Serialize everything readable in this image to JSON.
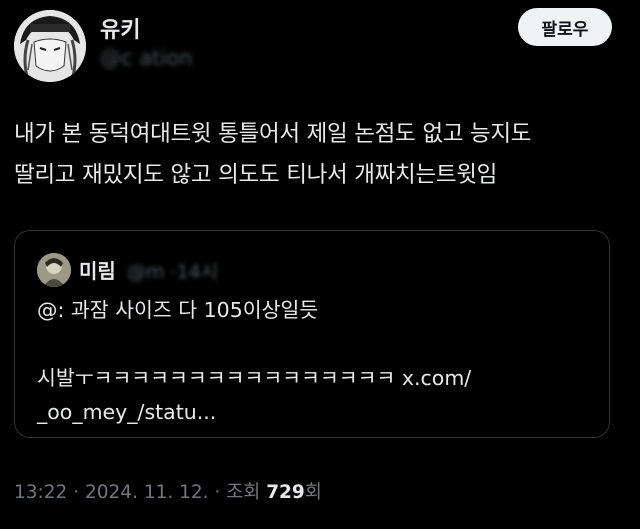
{
  "author": {
    "display_name": "유키",
    "handle": "@c          ation"
  },
  "follow_button": "팔로우",
  "tweet_lines": [
    "내가 본 동덕여대트윗 통틀어서 제일 논점도 없고 능지도",
    "딸리고 재밌지도 않고 의도도 티나서 개짜치는트윗임"
  ],
  "quote": {
    "display_name": "미림",
    "handle": "@m              ·14시",
    "lines": [
      "@: 과잠 사이즈 다 105이상일듯",
      "",
      "시발ㅜㅋㅋㅋㅋㅋㅋㅋㅋㅋㅋㅋㅋㅋㅋㅋㅋ x.com/",
      "_oo_mey_/statu..."
    ]
  },
  "meta": {
    "time": "13:22",
    "date": "2024. 11. 12.",
    "views_label": "조회",
    "views_count": "729",
    "views_suffix": "회",
    "separator": "·"
  },
  "colors": {
    "background": "#000000",
    "text": "#e7e9ea",
    "muted": "#71767b",
    "border": "#2f3336",
    "button_bg": "#eff3f4"
  }
}
